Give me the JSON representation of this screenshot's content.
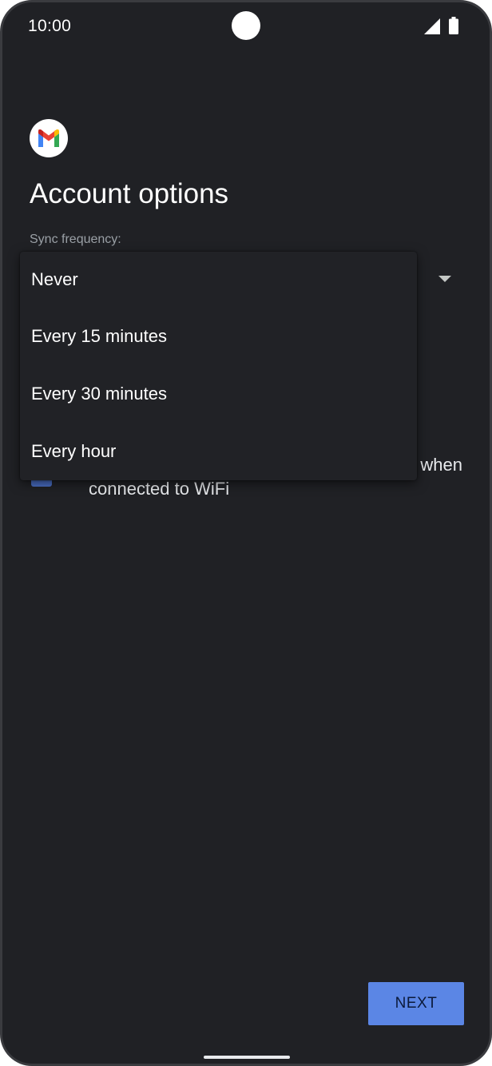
{
  "status_bar": {
    "time": "10:00"
  },
  "header": {
    "logo_icon": "gmail-logo-icon",
    "title": "Account options"
  },
  "sync": {
    "label": "Sync frequency:",
    "options": [
      "Never",
      "Every 15 minutes",
      "Every 30 minutes",
      "Every hour"
    ]
  },
  "wifi_option": {
    "line1": "when",
    "line2": "connected to WiFi"
  },
  "footer": {
    "next_label": "NEXT"
  },
  "colors": {
    "background": "#202125",
    "accent": "#5b86e5",
    "checkbox": "#4a6fc6"
  }
}
